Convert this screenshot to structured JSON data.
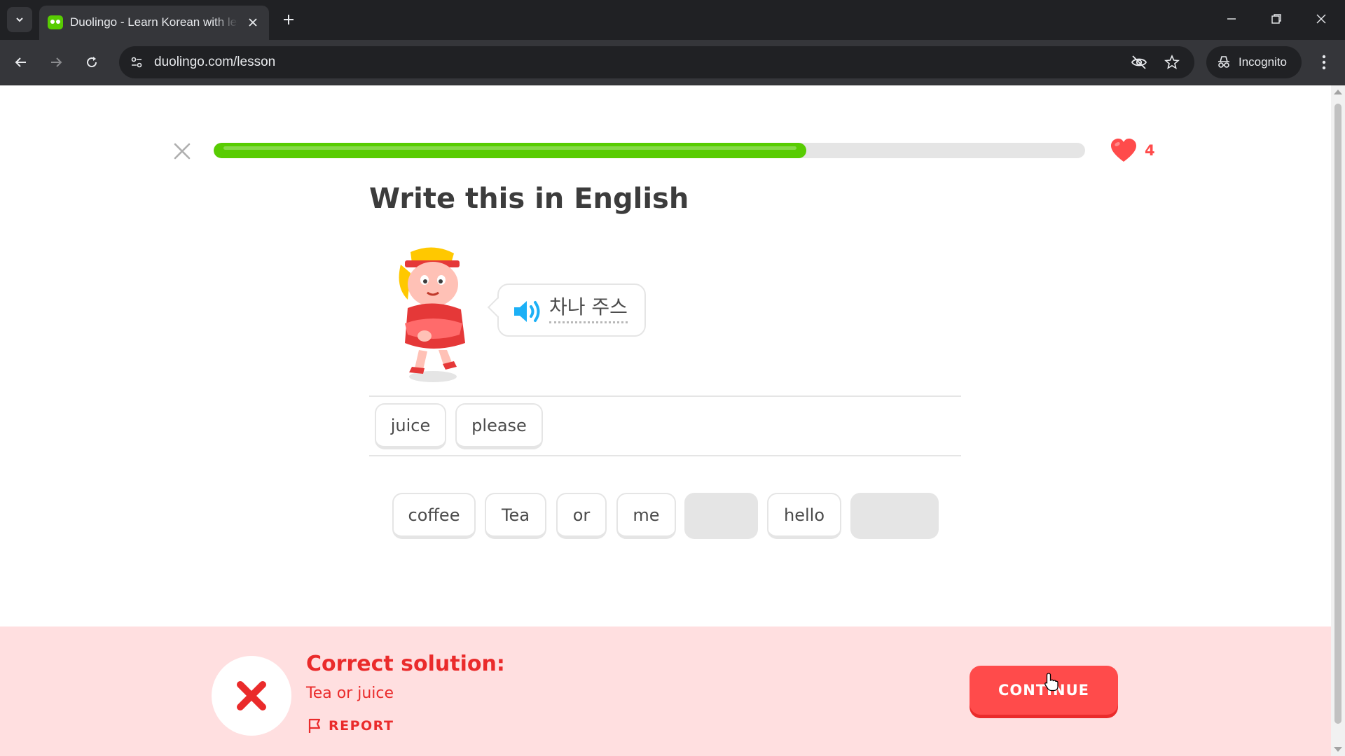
{
  "browser": {
    "tab_title": "Duolingo - Learn Korean with lessons",
    "url": "duolingo.com/lesson",
    "incognito_label": "Incognito"
  },
  "lesson": {
    "progress": 0.68,
    "hearts": "4",
    "prompt_title": "Write this in English",
    "source_text": "차나 주스",
    "answer_tiles": [
      "juice",
      "please"
    ],
    "word_bank": [
      "coffee",
      "Tea",
      "or",
      "me",
      "",
      "hello",
      ""
    ]
  },
  "feedback": {
    "heading": "Correct solution:",
    "solution": "Tea or juice",
    "report_label": "REPORT",
    "continue_label": "CONTINUE"
  },
  "colors": {
    "progress_green": "#58cc02",
    "error_red": "#ea2b2b",
    "button_red": "#ff4b4b",
    "footer_bg": "#ffdfe0"
  },
  "icons": [
    "search-tabs-icon",
    "close-icon",
    "plus-icon",
    "minimize-icon",
    "restore-icon",
    "back-icon",
    "forward-icon",
    "reload-icon",
    "site-info-icon",
    "eye-off-icon",
    "star-icon",
    "incognito-icon",
    "more-icon",
    "heart-icon",
    "speaker-icon",
    "x-mark-icon",
    "flag-icon"
  ]
}
